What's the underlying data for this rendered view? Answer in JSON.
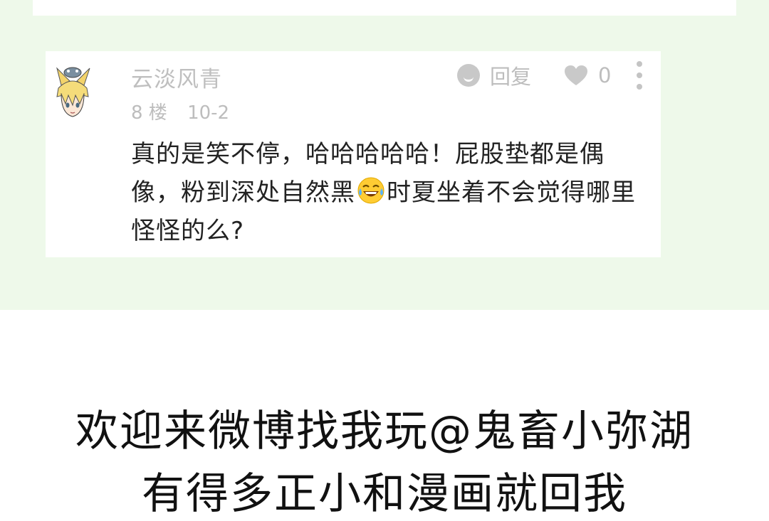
{
  "comment": {
    "username": "云淡风青",
    "floor": "8 楼",
    "date": "10-2",
    "reply_label": "回复",
    "like_count": "0",
    "text_part1": "真的是笑不停，哈哈哈哈哈！屁股垫都是偶像，粉到深处自然黑",
    "emoji_name": "tears-of-joy-emoji",
    "text_part2": "时夏坐着不会觉得哪里怪怪的么?",
    "icons": {
      "reply": "reply-bubble-icon",
      "like": "heart-icon",
      "more": "more-vertical-icon"
    }
  },
  "promo": {
    "line1": "欢迎来微博找我玩@鬼畜小弥湖",
    "line2_partial": "有得多正小和漫画就回我"
  },
  "colors": {
    "page_green": "#eef9ea",
    "card": "#ffffff",
    "muted_text": "#bdbdbd",
    "body_text": "#222222"
  }
}
